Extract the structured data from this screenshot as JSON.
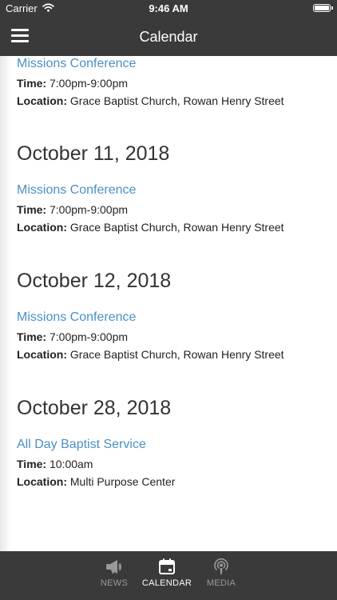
{
  "status_bar": {
    "carrier": "Carrier",
    "time": "9:46 AM",
    "battery_level": 1.0
  },
  "header": {
    "title": "Calendar"
  },
  "events": [
    {
      "title": "Missions Conference",
      "time_label": "Time:",
      "time": "7:00pm-9:00pm",
      "location_label": "Location:",
      "location": "Grace Baptist Church, Rowan Henry Street"
    }
  ],
  "days": [
    {
      "date": "October 11, 2018",
      "events": [
        {
          "title": "Missions Conference",
          "time_label": "Time:",
          "time": "7:00pm-9:00pm",
          "location_label": "Location:",
          "location": "Grace Baptist Church, Rowan Henry Street"
        }
      ]
    },
    {
      "date": "October 12, 2018",
      "events": [
        {
          "title": "Missions Conference",
          "time_label": "Time:",
          "time": "7:00pm-9:00pm",
          "location_label": "Location:",
          "location": "Grace Baptist Church, Rowan Henry Street"
        }
      ]
    },
    {
      "date": "October 28, 2018",
      "events": [
        {
          "title": "All Day Baptist Service",
          "time_label": "Time:",
          "time": "10:00am",
          "location_label": "Location:",
          "location": "Multi Purpose Center"
        }
      ]
    }
  ],
  "tabs": [
    {
      "label": "NEWS",
      "icon": "megaphone-icon",
      "active": false
    },
    {
      "label": "CALENDAR",
      "icon": "calendar-icon",
      "active": true
    },
    {
      "label": "MEDIA",
      "icon": "podcast-icon",
      "active": false
    }
  ],
  "colors": {
    "bar_background": "#3a3a3a",
    "link": "#4a90c4",
    "tab_active": "#ffffff",
    "tab_inactive": "#9a9a9a"
  }
}
